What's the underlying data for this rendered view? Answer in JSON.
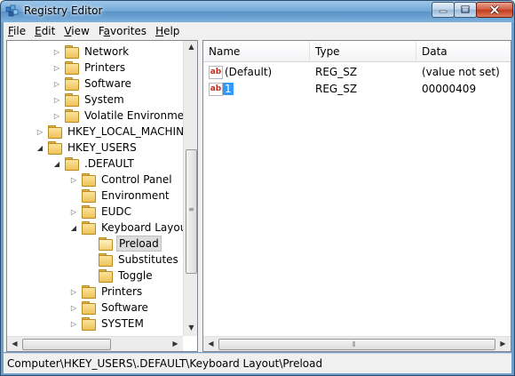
{
  "window": {
    "title": "Registry Editor"
  },
  "menu": [
    {
      "label": "File",
      "ul": "F",
      "rest": "ile"
    },
    {
      "label": "Edit",
      "ul": "E",
      "rest": "dit"
    },
    {
      "label": "View",
      "ul": "V",
      "rest": "iew"
    },
    {
      "label": "Favorites",
      "ul": "",
      "rest": "Favorites",
      "pre": "F",
      "u2": "a",
      "post": "vorites"
    },
    {
      "label": "Help",
      "ul": "H",
      "rest": "elp"
    }
  ],
  "tree": {
    "items": [
      {
        "label": "Network",
        "level": 2,
        "expander": "collapsed"
      },
      {
        "label": "Printers",
        "level": 2,
        "expander": "collapsed"
      },
      {
        "label": "Software",
        "level": 2,
        "expander": "collapsed"
      },
      {
        "label": "System",
        "level": 2,
        "expander": "collapsed"
      },
      {
        "label": "Volatile Environment",
        "level": 2,
        "expander": "collapsed"
      },
      {
        "label": "HKEY_LOCAL_MACHINE",
        "level": 1,
        "expander": "collapsed"
      },
      {
        "label": "HKEY_USERS",
        "level": 1,
        "expander": "expanded"
      },
      {
        "label": ".DEFAULT",
        "level": 2,
        "expander": "expanded"
      },
      {
        "label": "Control Panel",
        "level": 3,
        "expander": "collapsed"
      },
      {
        "label": "Environment",
        "level": 3,
        "expander": "none"
      },
      {
        "label": "EUDC",
        "level": 3,
        "expander": "collapsed"
      },
      {
        "label": "Keyboard Layout",
        "level": 3,
        "expander": "expanded"
      },
      {
        "label": "Preload",
        "level": 4,
        "expander": "none",
        "selected": true
      },
      {
        "label": "Substitutes",
        "level": 4,
        "expander": "none"
      },
      {
        "label": "Toggle",
        "level": 4,
        "expander": "none"
      },
      {
        "label": "Printers",
        "level": 3,
        "expander": "collapsed"
      },
      {
        "label": "Software",
        "level": 3,
        "expander": "collapsed"
      },
      {
        "label": "SYSTEM",
        "level": 3,
        "expander": "collapsed"
      }
    ]
  },
  "list": {
    "columns": [
      "Name",
      "Type",
      "Data"
    ],
    "rows": [
      {
        "name": "(Default)",
        "type": "REG_SZ",
        "data": "(value not set)",
        "editing": false
      },
      {
        "name": "1",
        "type": "REG_SZ",
        "data": "00000409",
        "editing": true
      }
    ]
  },
  "status": {
    "path": "Computer\\HKEY_USERS\\.DEFAULT\\Keyboard Layout\\Preload"
  }
}
